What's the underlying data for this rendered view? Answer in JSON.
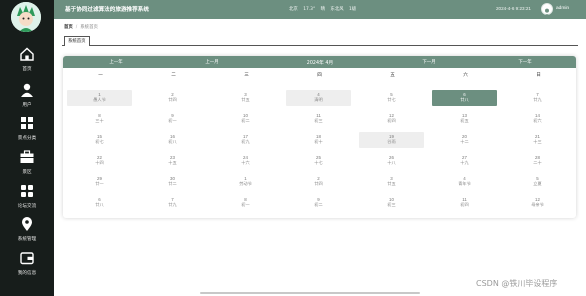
{
  "app": {
    "title": "基于协同过滤算法的旅游推荐系统",
    "weather": [
      "北京",
      "17.3°",
      "晴",
      "东北风",
      "1级"
    ],
    "datetime": "2024-4-6 9:23:21",
    "user": "admin"
  },
  "sidebar": {
    "items": [
      {
        "label": "首页",
        "icon": "home-icon"
      },
      {
        "label": "用户",
        "icon": "user-icon"
      },
      {
        "label": "景点分类",
        "icon": "category-icon"
      },
      {
        "label": "景区",
        "icon": "briefcase-icon"
      },
      {
        "label": "论坛交流",
        "icon": "forum-icon"
      },
      {
        "label": "系统管理",
        "icon": "map-pin-icon"
      },
      {
        "label": "我的信息",
        "icon": "wallet-icon"
      }
    ]
  },
  "breadcrumb": {
    "home": "首页",
    "current": "系统首页"
  },
  "tabs": [
    {
      "label": "系统首页"
    }
  ],
  "calendar": {
    "prev_year": "上一年",
    "prev_month": "上一月",
    "month_label": "2024年 4月",
    "next_month": "下一月",
    "next_year": "下一年",
    "weekdays": [
      "一",
      "二",
      "三",
      "四",
      "五",
      "六",
      "日"
    ],
    "weeks": [
      [
        {
          "d": "1",
          "l": "愚人节"
        },
        {
          "d": "2",
          "l": "廿四"
        },
        {
          "d": "3",
          "l": "廿五"
        },
        {
          "d": "4",
          "l": "清明"
        },
        {
          "d": "5",
          "l": "廿七"
        },
        {
          "d": "6",
          "l": "廿八"
        },
        {
          "d": "7",
          "l": "廿九"
        }
      ],
      [
        {
          "d": "8",
          "l": "三十"
        },
        {
          "d": "9",
          "l": "初一"
        },
        {
          "d": "10",
          "l": "初二"
        },
        {
          "d": "11",
          "l": "初三"
        },
        {
          "d": "12",
          "l": "初四"
        },
        {
          "d": "13",
          "l": "初五"
        },
        {
          "d": "14",
          "l": "初六"
        }
      ],
      [
        {
          "d": "15",
          "l": "初七"
        },
        {
          "d": "16",
          "l": "初八"
        },
        {
          "d": "17",
          "l": "初九"
        },
        {
          "d": "18",
          "l": "初十"
        },
        {
          "d": "19",
          "l": "谷雨"
        },
        {
          "d": "20",
          "l": "十二"
        },
        {
          "d": "21",
          "l": "十三"
        }
      ],
      [
        {
          "d": "22",
          "l": "十四"
        },
        {
          "d": "23",
          "l": "十五"
        },
        {
          "d": "24",
          "l": "十六"
        },
        {
          "d": "25",
          "l": "十七"
        },
        {
          "d": "26",
          "l": "十八"
        },
        {
          "d": "27",
          "l": "十九"
        },
        {
          "d": "28",
          "l": "二十"
        }
      ],
      [
        {
          "d": "29",
          "l": "廿一"
        },
        {
          "d": "30",
          "l": "廿二"
        },
        {
          "d": "1",
          "l": "劳动节"
        },
        {
          "d": "2",
          "l": "廿四"
        },
        {
          "d": "3",
          "l": "廿五"
        },
        {
          "d": "4",
          "l": "青年节"
        },
        {
          "d": "5",
          "l": "立夏"
        }
      ],
      [
        {
          "d": "6",
          "l": "廿八"
        },
        {
          "d": "7",
          "l": "廿九"
        },
        {
          "d": "8",
          "l": "初一"
        },
        {
          "d": "9",
          "l": "初二"
        },
        {
          "d": "10",
          "l": "初三"
        },
        {
          "d": "11",
          "l": "初四"
        },
        {
          "d": "12",
          "l": "母亲节"
        }
      ]
    ],
    "highlighted": [
      [
        0,
        0
      ],
      [
        0,
        3
      ],
      [
        2,
        4
      ]
    ],
    "selected": [
      0,
      5
    ]
  },
  "watermark": "CSDN @铁川毕设程序",
  "colors": {
    "accent": "#6c8f80",
    "sidebar": "#171d1b"
  }
}
